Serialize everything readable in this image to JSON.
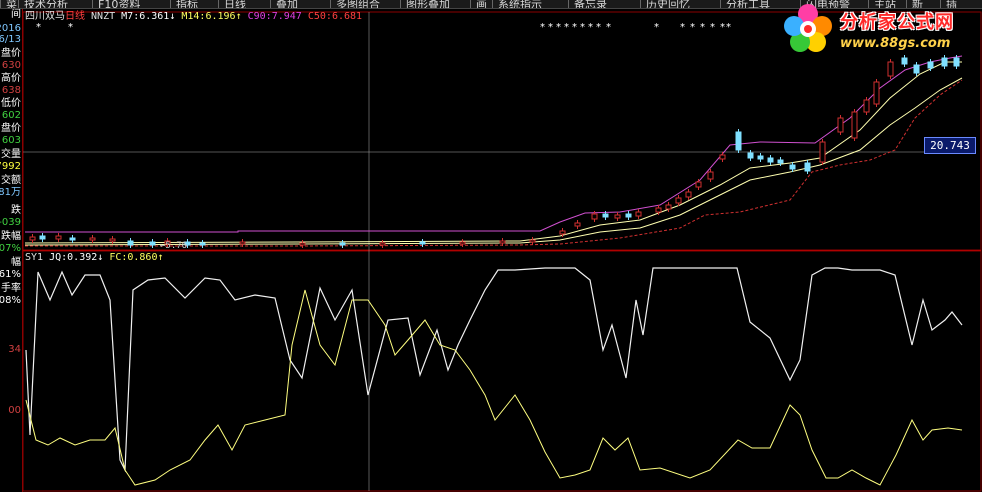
{
  "toolbar": {
    "items": [
      "菜",
      "技术分析",
      "F10资料",
      "指标",
      "日线",
      "叠加",
      "多图组合",
      "图形叠加",
      "画",
      "系统指示",
      "备忘录",
      "历史回忆",
      "分析工具",
      "闪电预警",
      "主站",
      "新",
      "插"
    ]
  },
  "left_panel": {
    "labels": [
      {
        "text": "间",
        "color": "#ffffff"
      },
      {
        "text": "2016",
        "color": "#7fc7ff"
      },
      {
        "text": "6/13",
        "color": "#7fc7ff"
      },
      {
        "text": "盘价",
        "color": "#ffffff"
      },
      {
        "text": "630",
        "color": "#d04040"
      },
      {
        "text": "高价",
        "color": "#ffffff"
      },
      {
        "text": "638",
        "color": "#d04040"
      },
      {
        "text": "低价",
        "color": "#ffffff"
      },
      {
        "text": "602",
        "color": "#40d040"
      },
      {
        "text": "盘价",
        "color": "#ffffff"
      },
      {
        "text": "603",
        "color": "#40d040"
      },
      {
        "text": "交量",
        "color": "#ffffff"
      },
      {
        "text": "7992",
        "color": "#ffff40"
      },
      {
        "text": "交额",
        "color": "#ffffff"
      },
      {
        "text": "81万",
        "color": "#7fc7ff"
      },
      {
        "text": "跌",
        "color": "#ffffff"
      },
      {
        "text": "-039",
        "color": "#40d040"
      },
      {
        "text": "跌幅",
        "color": "#ffffff"
      },
      {
        "text": "07%",
        "color": "#40d040"
      },
      {
        "text": "幅",
        "color": "#ffffff"
      },
      {
        "text": "61%",
        "color": "#ffffff"
      },
      {
        "text": "手率",
        "color": "#ffffff"
      },
      {
        "text": "08%",
        "color": "#ffffff"
      },
      {
        "text": "34",
        "color": "#d04040"
      },
      {
        "text": "00",
        "color": "#d04040"
      }
    ]
  },
  "main_header": {
    "stock_name": "四川双马",
    "period": "日线",
    "indicator": "NNZT",
    "m7_label": "M7:",
    "m7_value": "6.361↓",
    "m14_label": "M14:",
    "m14_value": "6.196↑",
    "c90_label": "C90:",
    "c90_value": "7.947",
    "c50_label": "C50:",
    "c50_value": "6.681"
  },
  "sub_header": {
    "indicator": "SY1",
    "jq_label": "JQ:",
    "jq_value": "0.392↓",
    "fc_label": "FC:",
    "fc_value": "0.860↑"
  },
  "price_tag": "20.743",
  "low_label": "←5.76",
  "logo": {
    "name": "分析家公式网",
    "url": "www.88gs.com"
  },
  "chart_data": [
    {
      "type": "candlestick",
      "series": [
        {
          "name": "M7"
        },
        {
          "name": "M14"
        },
        {
          "name": "C90"
        },
        {
          "name": "C50"
        }
      ],
      "current_price": 20.743,
      "low_price": 5.76
    },
    {
      "type": "line",
      "series": [
        {
          "name": "JQ",
          "value": 0.392
        },
        {
          "name": "FC",
          "value": 0.86
        }
      ]
    }
  ]
}
